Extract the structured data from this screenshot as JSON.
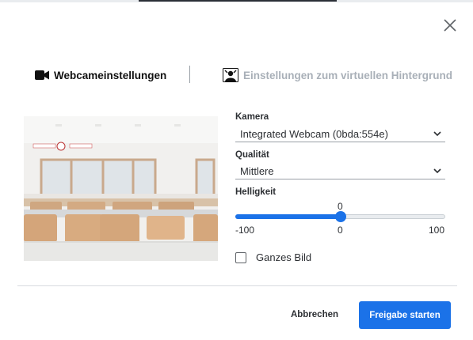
{
  "tabs": {
    "webcam_label": "Webcameinstellungen",
    "background_label": "Einstellungen zum virtuellen Hintergrund"
  },
  "form": {
    "camera_label": "Kamera",
    "camera_value": "Integrated Webcam (0bda:554e)",
    "quality_label": "Qualität",
    "quality_value": "Mittlere",
    "brightness_label": "Helligkeit",
    "brightness": {
      "min": -100,
      "max": 100,
      "value": 0,
      "min_label": "-100",
      "max_label": "100",
      "value_label": "0",
      "current_label": "0"
    },
    "full_image_label": "Ganzes Bild"
  },
  "footer": {
    "cancel_label": "Abbrechen",
    "start_label": "Freigabe starten"
  },
  "colors": {
    "accent": "#1b72e8",
    "disabled_tab": "#a9b0b8"
  },
  "icons": [
    "close-icon",
    "webcam-icon",
    "virtual-background-icon",
    "chevron-down-icon"
  ]
}
